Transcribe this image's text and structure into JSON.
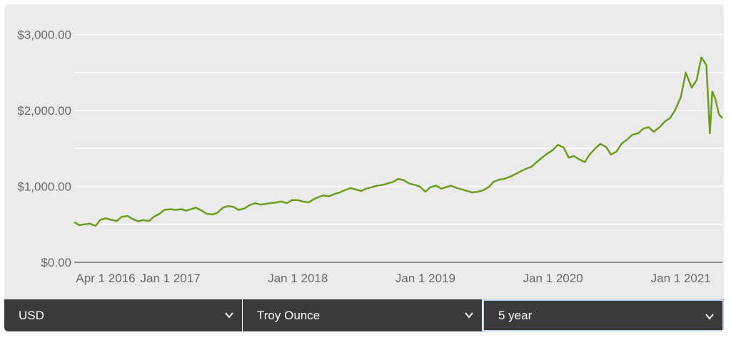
{
  "chart_data": {
    "type": "line",
    "y_ticks": [
      "$3,000.00",
      "$2,000.00",
      "$1,000.00",
      "$0.00"
    ],
    "y_tick_values": [
      3000,
      2000,
      1000,
      0
    ],
    "ylim": [
      0,
      3400
    ],
    "x_ticks": [
      "Apr 1 2016",
      "Jan 1 2017",
      "Jan 1 2018",
      "Jan 1 2019",
      "Jan 1 2020",
      "Jan 1 2021"
    ],
    "x_tick_dates": [
      "2016-04-01",
      "2017-01-01",
      "2018-01-01",
      "2019-01-01",
      "2020-01-01",
      "2021-01-01"
    ],
    "xlim": [
      "2016-04-01",
      "2021-04-30"
    ],
    "grid": true,
    "line_color": "#6f9c1e",
    "series": [
      {
        "points": [
          [
            "2016-04-01",
            530
          ],
          [
            "2016-04-15",
            490
          ],
          [
            "2016-05-01",
            500
          ],
          [
            "2016-05-15",
            510
          ],
          [
            "2016-06-01",
            480
          ],
          [
            "2016-06-15",
            560
          ],
          [
            "2016-07-01",
            580
          ],
          [
            "2016-07-15",
            560
          ],
          [
            "2016-08-01",
            545
          ],
          [
            "2016-08-15",
            600
          ],
          [
            "2016-09-01",
            610
          ],
          [
            "2016-09-15",
            570
          ],
          [
            "2016-10-01",
            540
          ],
          [
            "2016-10-15",
            555
          ],
          [
            "2016-11-01",
            545
          ],
          [
            "2016-11-15",
            600
          ],
          [
            "2016-12-01",
            640
          ],
          [
            "2016-12-15",
            690
          ],
          [
            "2017-01-01",
            700
          ],
          [
            "2017-01-15",
            690
          ],
          [
            "2017-02-01",
            700
          ],
          [
            "2017-02-15",
            680
          ],
          [
            "2017-03-01",
            700
          ],
          [
            "2017-03-15",
            720
          ],
          [
            "2017-04-01",
            680
          ],
          [
            "2017-04-15",
            640
          ],
          [
            "2017-05-01",
            630
          ],
          [
            "2017-05-15",
            650
          ],
          [
            "2017-06-01",
            720
          ],
          [
            "2017-06-15",
            740
          ],
          [
            "2017-07-01",
            730
          ],
          [
            "2017-07-15",
            690
          ],
          [
            "2017-08-01",
            710
          ],
          [
            "2017-08-15",
            750
          ],
          [
            "2017-09-01",
            780
          ],
          [
            "2017-09-15",
            760
          ],
          [
            "2017-10-01",
            770
          ],
          [
            "2017-10-15",
            780
          ],
          [
            "2017-11-01",
            790
          ],
          [
            "2017-11-15",
            800
          ],
          [
            "2017-12-01",
            780
          ],
          [
            "2017-12-15",
            820
          ],
          [
            "2018-01-01",
            820
          ],
          [
            "2018-01-15",
            800
          ],
          [
            "2018-02-01",
            790
          ],
          [
            "2018-02-15",
            830
          ],
          [
            "2018-03-01",
            860
          ],
          [
            "2018-03-15",
            880
          ],
          [
            "2018-04-01",
            870
          ],
          [
            "2018-04-15",
            900
          ],
          [
            "2018-05-01",
            920
          ],
          [
            "2018-05-15",
            950
          ],
          [
            "2018-06-01",
            980
          ],
          [
            "2018-06-15",
            960
          ],
          [
            "2018-07-01",
            940
          ],
          [
            "2018-07-15",
            970
          ],
          [
            "2018-08-01",
            990
          ],
          [
            "2018-08-15",
            1010
          ],
          [
            "2018-09-01",
            1020
          ],
          [
            "2018-09-15",
            1040
          ],
          [
            "2018-10-01",
            1060
          ],
          [
            "2018-10-15",
            1100
          ],
          [
            "2018-11-01",
            1080
          ],
          [
            "2018-11-15",
            1040
          ],
          [
            "2018-12-01",
            1020
          ],
          [
            "2018-12-15",
            1000
          ],
          [
            "2019-01-01",
            930
          ],
          [
            "2019-01-15",
            990
          ],
          [
            "2019-02-01",
            1010
          ],
          [
            "2019-02-15",
            970
          ],
          [
            "2019-03-01",
            990
          ],
          [
            "2019-03-15",
            1010
          ],
          [
            "2019-04-01",
            980
          ],
          [
            "2019-04-15",
            960
          ],
          [
            "2019-05-01",
            940
          ],
          [
            "2019-05-15",
            920
          ],
          [
            "2019-06-01",
            930
          ],
          [
            "2019-06-15",
            950
          ],
          [
            "2019-07-01",
            990
          ],
          [
            "2019-07-15",
            1060
          ],
          [
            "2019-08-01",
            1090
          ],
          [
            "2019-08-15",
            1100
          ],
          [
            "2019-09-01",
            1130
          ],
          [
            "2019-09-15",
            1160
          ],
          [
            "2019-10-01",
            1200
          ],
          [
            "2019-10-15",
            1230
          ],
          [
            "2019-11-01",
            1260
          ],
          [
            "2019-11-15",
            1320
          ],
          [
            "2019-12-01",
            1380
          ],
          [
            "2019-12-15",
            1430
          ],
          [
            "2020-01-01",
            1480
          ],
          [
            "2020-01-15",
            1550
          ],
          [
            "2020-02-01",
            1510
          ],
          [
            "2020-02-15",
            1380
          ],
          [
            "2020-03-01",
            1400
          ],
          [
            "2020-03-15",
            1360
          ],
          [
            "2020-04-01",
            1320
          ],
          [
            "2020-04-15",
            1420
          ],
          [
            "2020-05-01",
            1500
          ],
          [
            "2020-05-15",
            1560
          ],
          [
            "2020-06-01",
            1520
          ],
          [
            "2020-06-15",
            1420
          ],
          [
            "2020-07-01",
            1460
          ],
          [
            "2020-07-15",
            1560
          ],
          [
            "2020-08-01",
            1620
          ],
          [
            "2020-08-15",
            1680
          ],
          [
            "2020-09-01",
            1700
          ],
          [
            "2020-09-15",
            1760
          ],
          [
            "2020-10-01",
            1780
          ],
          [
            "2020-10-15",
            1720
          ],
          [
            "2020-11-01",
            1780
          ],
          [
            "2020-11-15",
            1850
          ],
          [
            "2020-12-01",
            1900
          ],
          [
            "2020-12-15",
            2000
          ],
          [
            "2021-01-01",
            2180
          ],
          [
            "2021-01-15",
            2500
          ],
          [
            "2021-02-01",
            2300
          ],
          [
            "2021-02-15",
            2400
          ],
          [
            "2021-03-01",
            2700
          ],
          [
            "2021-03-15",
            2600
          ],
          [
            "2021-03-25",
            1700
          ],
          [
            "2021-04-01",
            2250
          ],
          [
            "2021-04-10",
            2150
          ],
          [
            "2021-04-20",
            1950
          ],
          [
            "2021-04-30",
            1900
          ]
        ]
      }
    ]
  },
  "controls": {
    "currency": "USD",
    "unit": "Troy Ounce",
    "period": "5 year"
  }
}
